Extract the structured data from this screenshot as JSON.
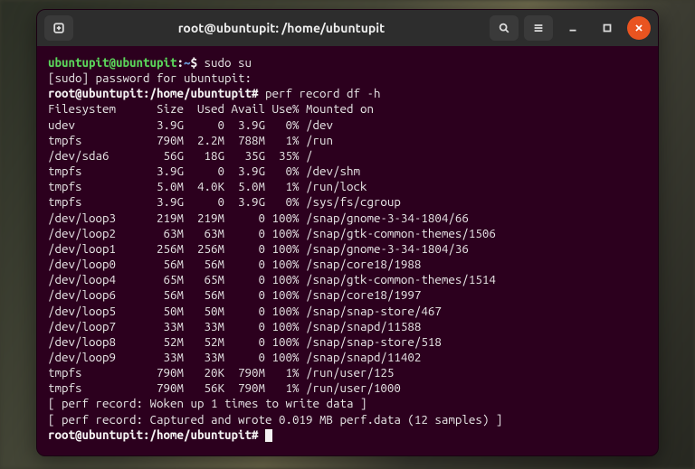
{
  "title": "root@ubuntupit: /home/ubuntupit",
  "prompt1_user": "ubuntupit@ubuntupit",
  "prompt1_path": "~",
  "prompt1_cmd": "sudo su",
  "sudo_line": "[sudo] password for ubuntupit:",
  "prompt2_user": "root@ubuntupit",
  "prompt2_path": "/home/ubuntupit",
  "prompt2_cmd": "perf record df -h",
  "header": "Filesystem      Size  Used Avail Use% Mounted on",
  "rows": [
    "udev            3.9G     0  3.9G   0% /dev",
    "tmpfs           790M  2.2M  788M   1% /run",
    "/dev/sda6        56G   18G   35G  35% /",
    "tmpfs           3.9G     0  3.9G   0% /dev/shm",
    "tmpfs           5.0M  4.0K  5.0M   1% /run/lock",
    "tmpfs           3.9G     0  3.9G   0% /sys/fs/cgroup",
    "/dev/loop3      219M  219M     0 100% /snap/gnome-3-34-1804/66",
    "/dev/loop2       63M   63M     0 100% /snap/gtk-common-themes/1506",
    "/dev/loop1      256M  256M     0 100% /snap/gnome-3-34-1804/36",
    "/dev/loop0       56M   56M     0 100% /snap/core18/1988",
    "/dev/loop4       65M   65M     0 100% /snap/gtk-common-themes/1514",
    "/dev/loop6       56M   56M     0 100% /snap/core18/1997",
    "/dev/loop5       50M   50M     0 100% /snap/snap-store/467",
    "/dev/loop7       33M   33M     0 100% /snap/snapd/11588",
    "/dev/loop8       52M   52M     0 100% /snap/snap-store/518",
    "/dev/loop9       33M   33M     0 100% /snap/snapd/11402",
    "tmpfs           790M   20K  790M   1% /run/user/125",
    "tmpfs           790M   56K  790M   1% /run/user/1000"
  ],
  "perf1": "[ perf record: Woken up 1 times to write data ]",
  "perf2": "[ perf record: Captured and wrote 0.019 MB perf.data (12 samples) ]"
}
